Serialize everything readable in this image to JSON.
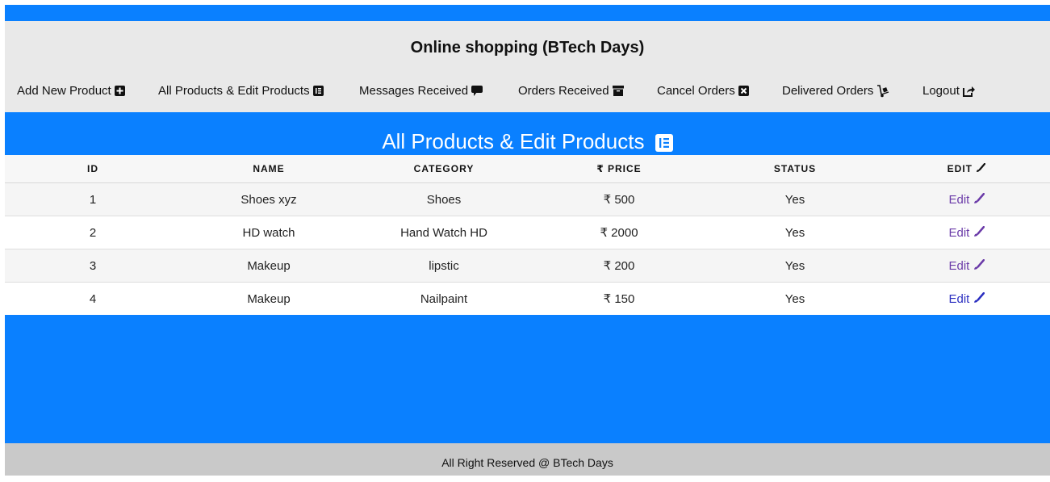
{
  "site": {
    "title": "Online shopping (BTech Days)"
  },
  "nav": [
    {
      "label": "Add New Product",
      "icon": "plus-square-icon"
    },
    {
      "label": "All Products & Edit Products",
      "icon": "list-box-icon"
    },
    {
      "label": "Messages Received",
      "icon": "comment-icon"
    },
    {
      "label": "Orders Received",
      "icon": "archive-icon"
    },
    {
      "label": "Cancel Orders",
      "icon": "close-square-icon"
    },
    {
      "label": "Delivered Orders",
      "icon": "dolly-icon"
    },
    {
      "label": "Logout",
      "icon": "share-square-icon"
    }
  ],
  "section": {
    "title": "All Products & Edit Products"
  },
  "table": {
    "headers": [
      "ID",
      "NAME",
      "CATEGORY",
      "₹ PRICE",
      "STATUS",
      "EDIT"
    ],
    "rows": [
      {
        "id": "1",
        "name": "Shoes xyz",
        "category": "Shoes",
        "price": "₹ 500",
        "status": "Yes",
        "edit": "Edit"
      },
      {
        "id": "2",
        "name": "HD watch",
        "category": "Hand Watch HD",
        "price": "₹ 2000",
        "status": "Yes",
        "edit": "Edit"
      },
      {
        "id": "3",
        "name": "Makeup",
        "category": "lipstic",
        "price": "₹ 200",
        "status": "Yes",
        "edit": "Edit"
      },
      {
        "id": "4",
        "name": "Makeup",
        "category": "Nailpaint",
        "price": "₹ 150",
        "status": "Yes",
        "edit": "Edit"
      }
    ]
  },
  "footer": {
    "text": "All Right Reserved @ BTech Days"
  },
  "colors": {
    "primary": "#0a80ff",
    "header_bg": "#e9e9e9",
    "footer_bg": "#c9c9c9",
    "link": "#6a3aa8"
  }
}
